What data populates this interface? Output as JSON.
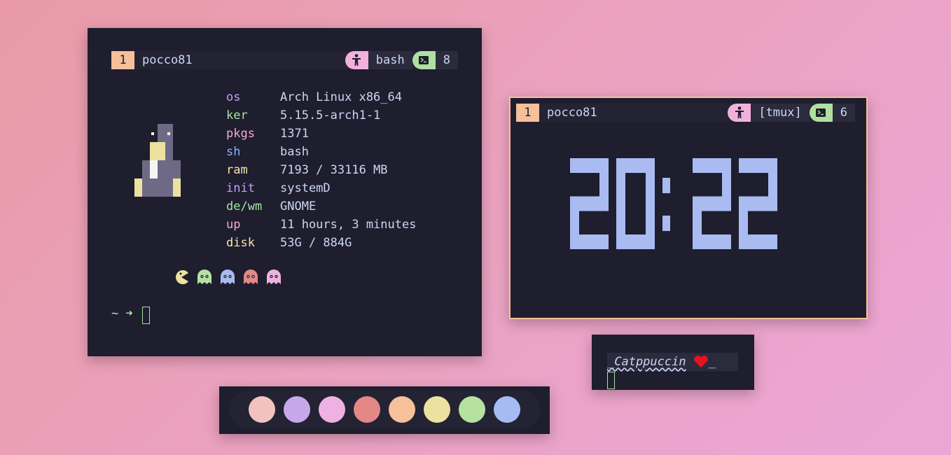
{
  "terminal_main": {
    "window_index": "1",
    "hostname": "pocco81",
    "shell_label": "bash",
    "pane_count": "8",
    "icons": {
      "user": "accessibility-icon",
      "terminal": "terminal-icon"
    },
    "fetch": [
      {
        "key": "os",
        "value": "Arch Linux x86_64",
        "color": "#c6a0f6"
      },
      {
        "key": "ker",
        "value": "5.15.5-arch1-1",
        "color": "#a6e3a1"
      },
      {
        "key": "pkgs",
        "value": "1371",
        "color": "#f5a8d8"
      },
      {
        "key": "sh",
        "value": "bash",
        "color": "#89b4fa"
      },
      {
        "key": "ram",
        "value": "7193 / 33116 MB",
        "color": "#f9e2af"
      },
      {
        "key": "init",
        "value": "systemD",
        "color": "#c6a0f6"
      },
      {
        "key": "de/wm",
        "value": "GNOME",
        "color": "#a6e3a1"
      },
      {
        "key": "up",
        "value": "11 hours, 3 minutes",
        "color": "#f5a8d8"
      },
      {
        "key": "disk",
        "value": "53G / 884G",
        "color": "#f9e2af"
      }
    ],
    "sprites": [
      "pacman-icon",
      "ghost-green-icon",
      "ghost-blue-icon",
      "ghost-red-icon",
      "ghost-pink-icon"
    ],
    "prompt": {
      "tilde": "~",
      "arrow": "➜"
    }
  },
  "terminal_clock": {
    "window_index": "1",
    "hostname": "pocco81",
    "session_label": "[tmux]",
    "pane_count": "6",
    "time": "20:22",
    "clock_color": "#a9bbf1"
  },
  "tag_window": {
    "text": "_Catppuccin",
    "heart_icon": "heart-icon",
    "suffix": "_"
  },
  "palette": {
    "colors": [
      "#f2c2c1",
      "#c6a8ea",
      "#eeb2e2",
      "#e48787",
      "#f5c09a",
      "#ede1a0",
      "#b6e2a0",
      "#a6bbf1"
    ]
  }
}
